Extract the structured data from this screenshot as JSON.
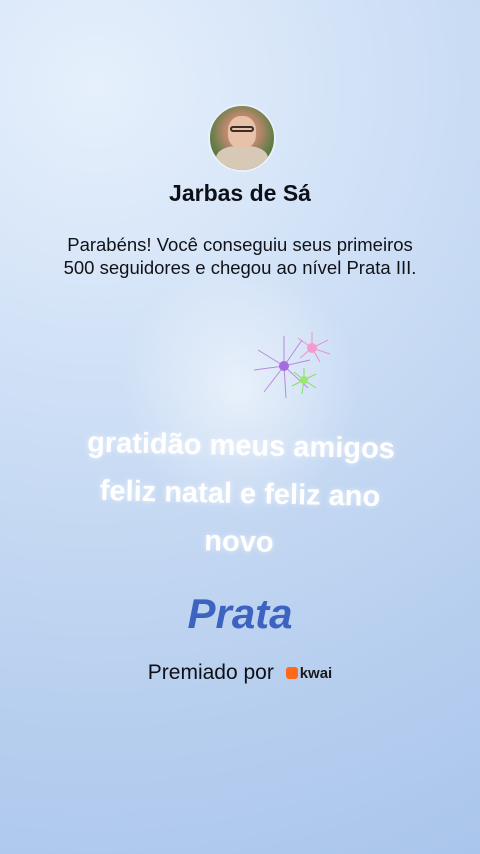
{
  "profile": {
    "name": "Jarbas de Sá"
  },
  "message": "Parabéns! Você conseguiu seus primeiros 500 seguidores e chegou ao nível Prata III.",
  "caption": {
    "lines": [
      "gratidão meus amigos",
      "feliz natal e feliz ano",
      "novo"
    ]
  },
  "level": {
    "title": "Prata"
  },
  "award": {
    "label": "Premiado por",
    "brand": "kwai"
  },
  "colors": {
    "level_text": "#3c63c0",
    "brand_icon": "#ff6a1a"
  }
}
